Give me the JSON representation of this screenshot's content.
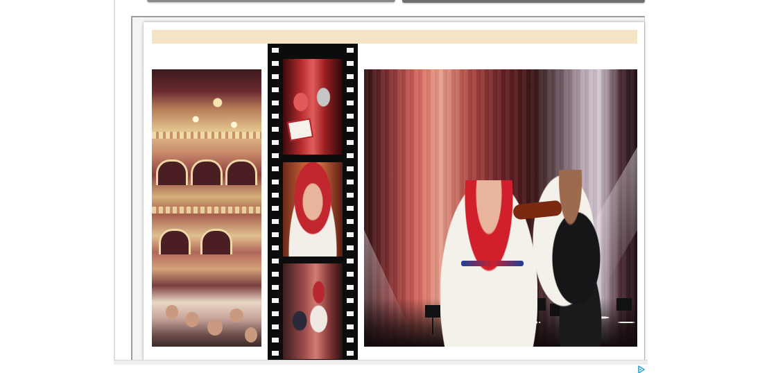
{
  "colors": {
    "band": "#f6e5c4",
    "frame_border": "#9c9c9c",
    "adchoices": "#22a6d8",
    "filmstrip": "#0c0c0c"
  },
  "gallery": {
    "photos": [
      {
        "name": "theatre-interior-photo"
      },
      {
        "name": "film-strip-collage"
      },
      {
        "name": "stage-performance-photo"
      }
    ],
    "filmstrip_frames": 3
  },
  "ad": {
    "icon": "adchoices-icon"
  }
}
